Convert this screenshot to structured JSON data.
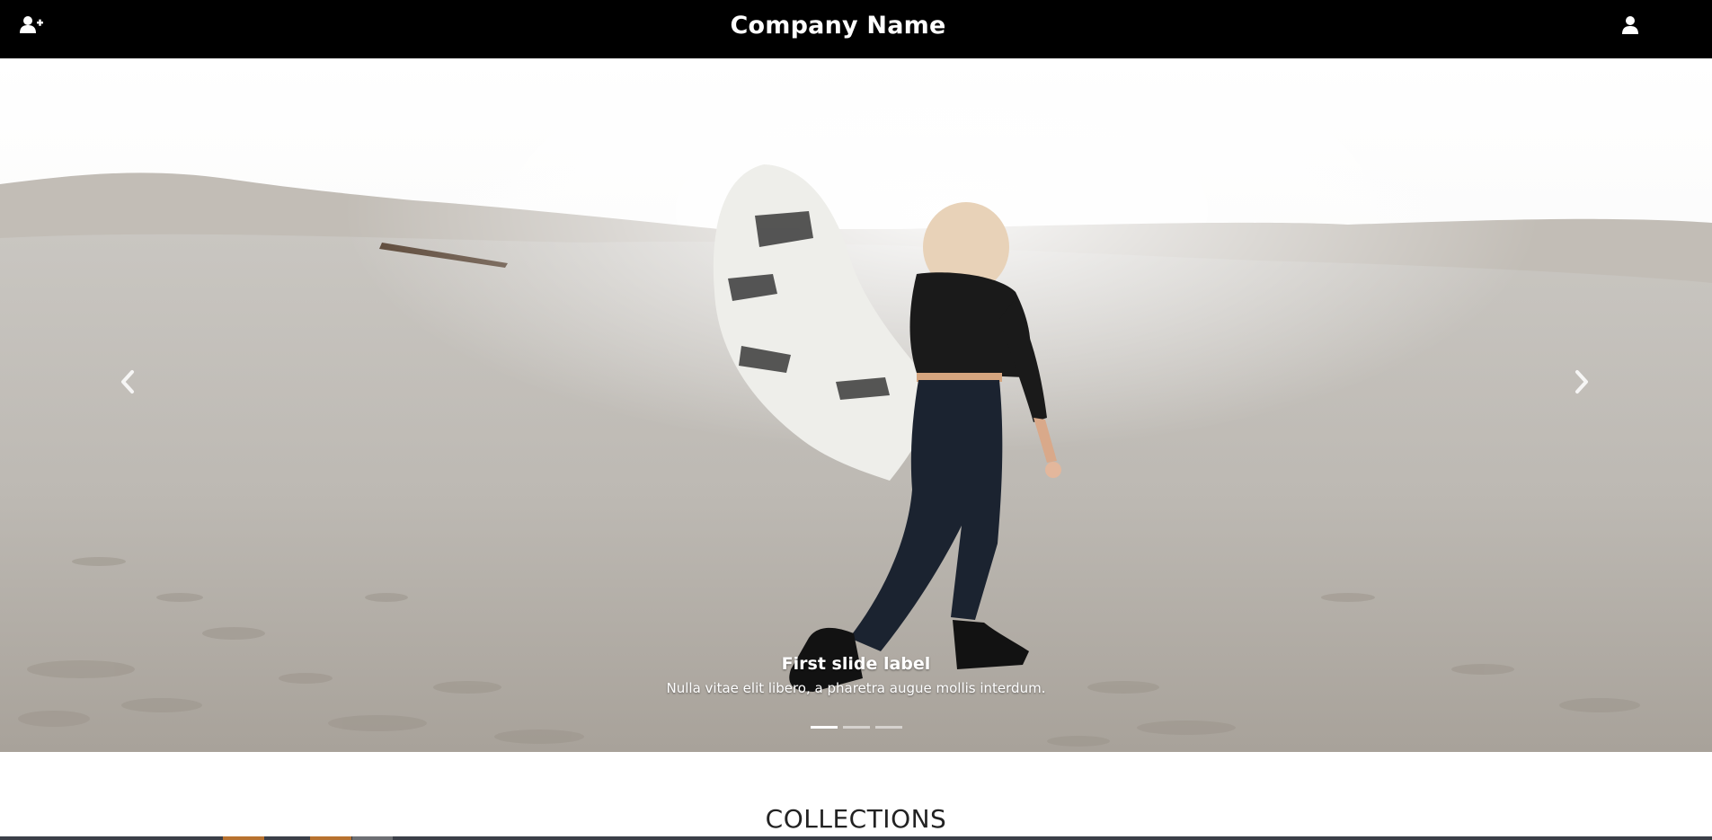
{
  "navbar": {
    "brand": "Company Name",
    "left_icon": "user-plus-icon",
    "right_icon": "user-icon"
  },
  "carousel": {
    "prev_icon": "chevron-left-icon",
    "next_icon": "chevron-right-icon",
    "slide": {
      "label": "First slide label",
      "text": "Nulla vitae elit libero, a pharetra augue mollis interdum."
    },
    "indicators": [
      {
        "active": true
      },
      {
        "active": false
      },
      {
        "active": false
      }
    ]
  },
  "collections": {
    "title": "COLLECTIONS"
  },
  "colors": {
    "navbar_bg": "#000000",
    "text_light": "#ffffff",
    "heading": "#222222"
  }
}
